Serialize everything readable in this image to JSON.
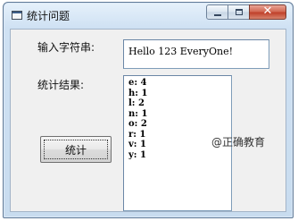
{
  "window": {
    "title": "统计问题",
    "app_icon": "app-window-icon",
    "buttons": {
      "minimize": "minimize-icon",
      "maximize": "maximize-icon",
      "close": "close-icon",
      "close_glyph": "✕"
    }
  },
  "form": {
    "input_label": "输入字符串:",
    "input_value": "Hello 123 EveryOne!",
    "result_label": "统计结果:",
    "results": [
      "e: 4",
      "h: 1",
      "l: 2",
      "n: 1",
      "o: 2",
      "r: 1",
      "v: 1",
      "y: 1"
    ],
    "count_button": "统计"
  },
  "watermark": "@正确教育",
  "colors": {
    "title_bar": "#cfe1f3",
    "client_bg": "#f0f0f0",
    "close_button": "#c0412b"
  }
}
